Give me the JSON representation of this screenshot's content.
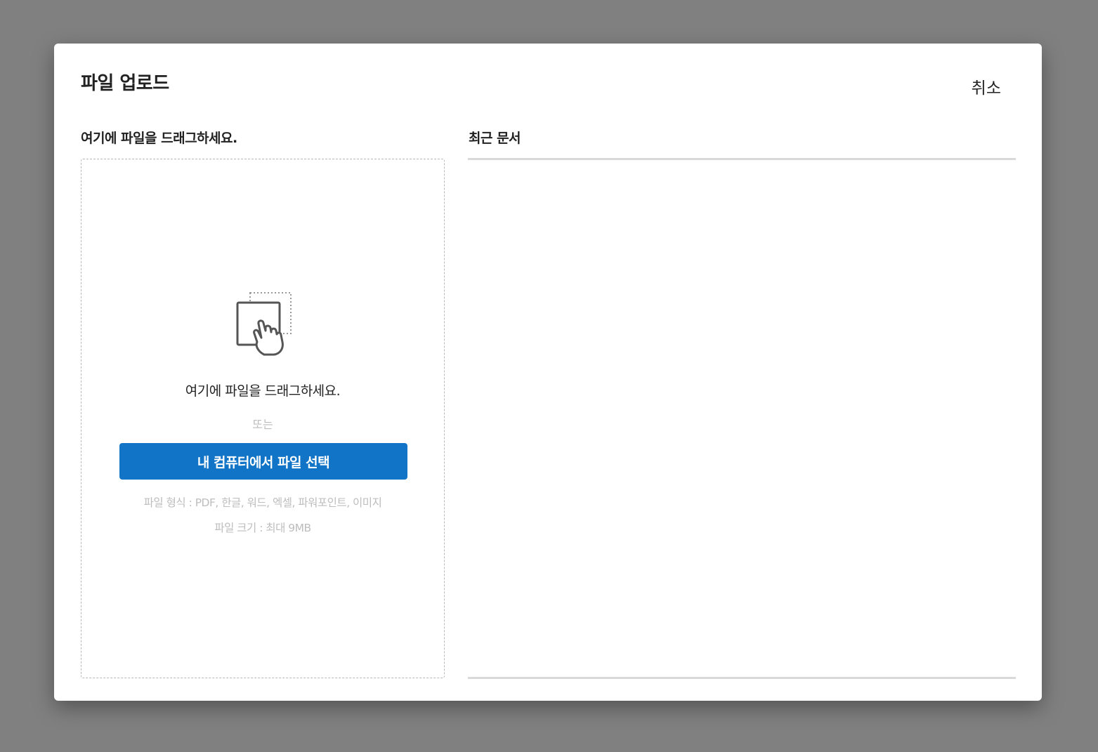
{
  "dialog": {
    "title": "파일 업로드",
    "cancel_label": "취소"
  },
  "upload": {
    "heading": "여기에 파일을 드래그하세요.",
    "icon": "drag-hand-icon",
    "drop_text": "여기에 파일을 드래그하세요.",
    "or_text": "또는",
    "select_button_label": "내 컴퓨터에서 파일 선택",
    "format_text": "파일 형식 : PDF, 한글, 워드, 엑셀, 파워포인트, 이미지",
    "size_text": "파일 크기 : 최대 9MB"
  },
  "recent": {
    "heading": "최근 문서",
    "items": []
  },
  "colors": {
    "accent": "#1174c6",
    "overlay": "#808080",
    "muted_text": "#bdbdbd"
  }
}
